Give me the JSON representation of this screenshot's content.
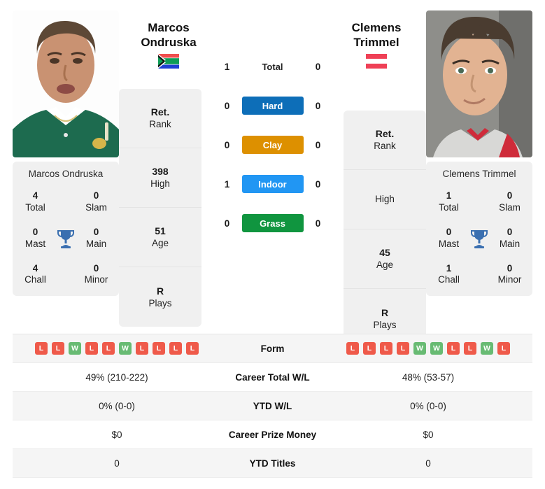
{
  "players": {
    "left": {
      "name_line1": "Marcos",
      "name_line2": "Ondruska",
      "full_name": "Marcos Ondruska",
      "flag": "za-flag-icon",
      "rank": "Ret.",
      "rank_label": "Rank",
      "high": "398",
      "high_label": "High",
      "age": "51",
      "age_label": "Age",
      "plays": "R",
      "plays_label": "Plays",
      "titles": {
        "total": "4",
        "total_label": "Total",
        "slam": "0",
        "slam_label": "Slam",
        "mast": "0",
        "mast_label": "Mast",
        "main": "0",
        "main_label": "Main",
        "chall": "4",
        "chall_label": "Chall",
        "minor": "0",
        "minor_label": "Minor"
      },
      "form": [
        "L",
        "L",
        "W",
        "L",
        "L",
        "W",
        "L",
        "L",
        "L",
        "L"
      ],
      "career_wl": "49% (210-222)",
      "ytd_wl": "0% (0-0)",
      "prize": "$0",
      "ytd_titles": "0"
    },
    "right": {
      "name_line1": "Clemens",
      "name_line2": "Trimmel",
      "full_name": "Clemens Trimmel",
      "flag": "at-flag-icon",
      "rank": "Ret.",
      "rank_label": "Rank",
      "high": "",
      "high_label": "High",
      "age": "45",
      "age_label": "Age",
      "plays": "R",
      "plays_label": "Plays",
      "titles": {
        "total": "1",
        "total_label": "Total",
        "slam": "0",
        "slam_label": "Slam",
        "mast": "0",
        "mast_label": "Mast",
        "main": "0",
        "main_label": "Main",
        "chall": "1",
        "chall_label": "Chall",
        "minor": "0",
        "minor_label": "Minor"
      },
      "form": [
        "L",
        "L",
        "L",
        "L",
        "W",
        "W",
        "L",
        "L",
        "W",
        "L"
      ],
      "career_wl": "48% (53-57)",
      "ytd_wl": "0% (0-0)",
      "prize": "$0",
      "ytd_titles": "0"
    }
  },
  "h2h": {
    "rows": [
      {
        "label": "Total",
        "left": "1",
        "right": "0",
        "color": "",
        "plain": true
      },
      {
        "label": "Hard",
        "left": "0",
        "right": "0",
        "color": "#0d6eb8",
        "plain": false
      },
      {
        "label": "Clay",
        "left": "0",
        "right": "0",
        "color": "#dd9000",
        "plain": false
      },
      {
        "label": "Indoor",
        "left": "1",
        "right": "0",
        "color": "#2196f3",
        "plain": false
      },
      {
        "label": "Grass",
        "left": "0",
        "right": "0",
        "color": "#10953f",
        "plain": false
      }
    ]
  },
  "table": {
    "rows": [
      {
        "label": "Form",
        "type": "form"
      },
      {
        "label": "Career Total W/L",
        "type": "text",
        "key": "career_wl"
      },
      {
        "label": "YTD W/L",
        "type": "text",
        "key": "ytd_wl"
      },
      {
        "label": "Career Prize Money",
        "type": "text",
        "key": "prize"
      },
      {
        "label": "YTD Titles",
        "type": "text",
        "key": "ytd_titles"
      }
    ]
  },
  "colors": {
    "hard": "#0d6eb8",
    "clay": "#dd9000",
    "indoor": "#2196f3",
    "grass": "#10953f",
    "win": "#68bb73",
    "loss": "#ef5a4a",
    "trophy": "#3a6fb0",
    "card_bg": "#f0f0f0"
  }
}
